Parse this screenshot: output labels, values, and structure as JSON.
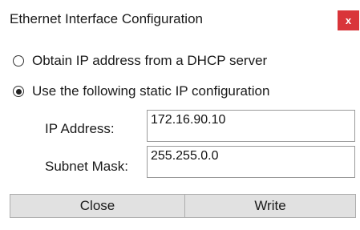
{
  "window": {
    "title": "Ethernet Interface Configuration",
    "close_glyph": "x"
  },
  "options": {
    "dhcp_label": "Obtain IP address from a DHCP server",
    "dhcp_selected": false,
    "static_label": "Use the following static IP configuration",
    "static_selected": true
  },
  "fields": {
    "ip_label": "IP Address:",
    "ip_value": "172.16.90.10",
    "mask_label": "Subnet Mask:",
    "mask_value": "255.255.0.0"
  },
  "buttons": {
    "close_label": "Close",
    "write_label": "Write"
  },
  "colors": {
    "close_button_bg": "#d9353a",
    "button_bg": "#e1e1e1"
  }
}
